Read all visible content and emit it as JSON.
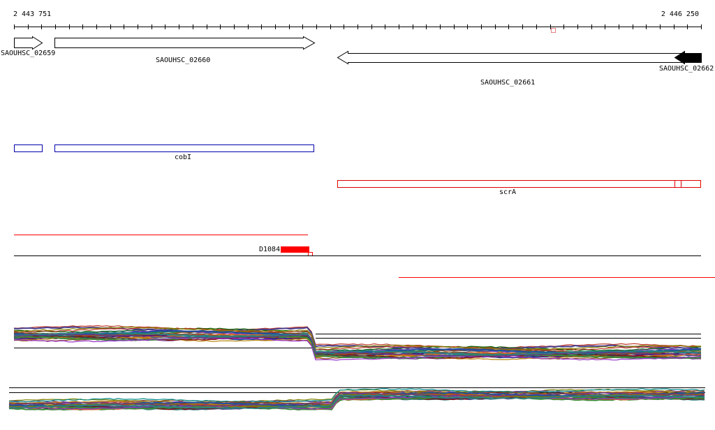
{
  "ruler": {
    "start_label": "2 443 751",
    "end_label": "2 446 250"
  },
  "genes": [
    {
      "label": "SAOUHSC_02659",
      "strand": "+",
      "fill": "#ffffff"
    },
    {
      "label": "SAOUHSC_02660",
      "strand": "+",
      "fill": "#ffffff"
    },
    {
      "label": "SAOUHSC_02661",
      "strand": "-",
      "fill": "#ffffff"
    },
    {
      "label": "SAOUHSC_02662",
      "strand": "-",
      "fill": "#000000"
    }
  ],
  "operons": [
    {
      "label": "",
      "color": "#0000aa"
    },
    {
      "label": "cobI",
      "color": "#0000aa"
    },
    {
      "label": "scrA",
      "color": "#dd0000"
    }
  ],
  "feature": {
    "label": "D1084",
    "color": "#ff0000"
  },
  "colors": {
    "ruler": "#000000",
    "coverage_red": "#ff0000",
    "gene_outline": "#000000"
  },
  "chart_data": {
    "type": "line",
    "tracks": [
      {
        "name": "",
        "description": "expression profiles, top track"
      },
      {
        "name": "",
        "description": "expression profiles, bottom track"
      }
    ]
  }
}
